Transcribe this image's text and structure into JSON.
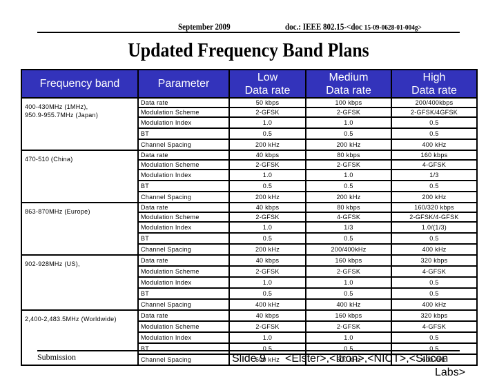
{
  "header": {
    "date": "September 2009",
    "doc_prefix": "doc.: IEEE 802.15-<doc ",
    "doc_number": "15-09-0628-01-004g>"
  },
  "title": "Updated Frequency Band Plans",
  "table": {
    "columns": [
      "Frequency band",
      "Parameter",
      "Low Data rate",
      "Medium Data rate",
      "High Data rate"
    ],
    "column_lines": [
      [
        "Frequency band"
      ],
      [
        "Parameter"
      ],
      [
        "Low",
        "Data rate"
      ],
      [
        "Medium",
        "Data rate"
      ],
      [
        "High",
        "Data rate"
      ]
    ],
    "bands": [
      {
        "band_lines": [
          "400-430MHz (1MHz),",
          "950.9-955.7MHz (Japan)"
        ],
        "rows": [
          {
            "param": "Data rate",
            "low": "50 kbps",
            "medium": "100 kbps",
            "high": "200/400kbps"
          },
          {
            "param": "Modulation Scheme",
            "low": "2-GFSK",
            "medium": "2-GFSK",
            "high": "2-GFSK/4GFSK"
          },
          {
            "param": "Modulation Index",
            "low": "1.0",
            "medium": "1.0",
            "high": "0.5"
          },
          {
            "param": "BT",
            "low": "0.5",
            "medium": "0.5",
            "high": "0.5"
          },
          {
            "param": "Channel Spacing",
            "low": "200 kHz",
            "medium": "200 kHz",
            "high": "400 kHz"
          }
        ]
      },
      {
        "band_lines": [
          "470-510 (China)"
        ],
        "rows": [
          {
            "param": "Data rate",
            "low": "40 kbps",
            "medium": "80 kbps",
            "high": "160 kbps"
          },
          {
            "param": "Modulation Scheme",
            "low": "2-GFSK",
            "medium": "2-GFSK",
            "high": "4-GFSK"
          },
          {
            "param": "Modulation Index",
            "low": "1.0",
            "medium": "1.0",
            "high": "1/3"
          },
          {
            "param": "BT",
            "low": "0.5",
            "medium": "0.5",
            "high": "0.5"
          },
          {
            "param": "Channel Spacing",
            "low": "200 kHz",
            "medium": "200 kHz",
            "high": "200 kHz"
          }
        ]
      },
      {
        "band_lines": [
          "863-870MHz (Europe)"
        ],
        "rows": [
          {
            "param": "Data rate",
            "low": "40 kbps",
            "medium": "80 kbps",
            "high": "160/320 kbps"
          },
          {
            "param": "Modulation Scheme",
            "low": "2-GFSK",
            "medium": "4-GFSK",
            "high": "2-GFSK/4-GFSK"
          },
          {
            "param": "Modulation Index",
            "low": "1.0",
            "medium": "1/3",
            "high": "1.0/(1/3)"
          },
          {
            "param": "BT",
            "low": "0.5",
            "medium": "0.5",
            "high": "0.5"
          },
          {
            "param": "Channel Spacing",
            "low": "200 kHz",
            "medium": "200/400kHz",
            "high": "400 kHz"
          }
        ]
      },
      {
        "band_lines": [
          "902-928MHz (US),"
        ],
        "rows": [
          {
            "param": "Data rate",
            "low": "40 kbps",
            "medium": "160 kbps",
            "high": "320 kbps"
          },
          {
            "param": "Modulation Scheme",
            "low": "2-GFSK",
            "medium": "2-GFSK",
            "high": "4-GFSK"
          },
          {
            "param": "Modulation Index",
            "low": "1.0",
            "medium": "1.0",
            "high": "0.5"
          },
          {
            "param": "BT",
            "low": "0.5",
            "medium": "0.5",
            "high": "0.5"
          },
          {
            "param": "Channel Spacing",
            "low": "400 kHz",
            "medium": "400 kHz",
            "high": "400 kHz"
          }
        ]
      },
      {
        "band_lines": [
          "2,400-2,483.5MHz (Worldwide)"
        ],
        "rows": [
          {
            "param": "Data rate",
            "low": "40 kbps",
            "medium": "160 kbps",
            "high": "320 kbps"
          },
          {
            "param": "Modulation Scheme",
            "low": "2-GFSK",
            "medium": "2-GFSK",
            "high": "4-GFSK"
          },
          {
            "param": "Modulation Index",
            "low": "1.0",
            "medium": "1.0",
            "high": "0.5"
          },
          {
            "param": "BT",
            "low": "0.5",
            "medium": "0.5",
            "high": "0.5"
          },
          {
            "param": "Channel Spacing",
            "low": "600 kHz",
            "medium": "600 kHz",
            "high": "600 kHz"
          }
        ]
      }
    ]
  },
  "footer": {
    "submission": "Submission",
    "slide": "Slide 9",
    "authors_line1": "<Elster>,<Itron>,<NICT>,<Silicon",
    "authors_line2": "Labs>"
  },
  "colors": {
    "header_bg": "#3333bb",
    "header_text": "#ffffff"
  }
}
